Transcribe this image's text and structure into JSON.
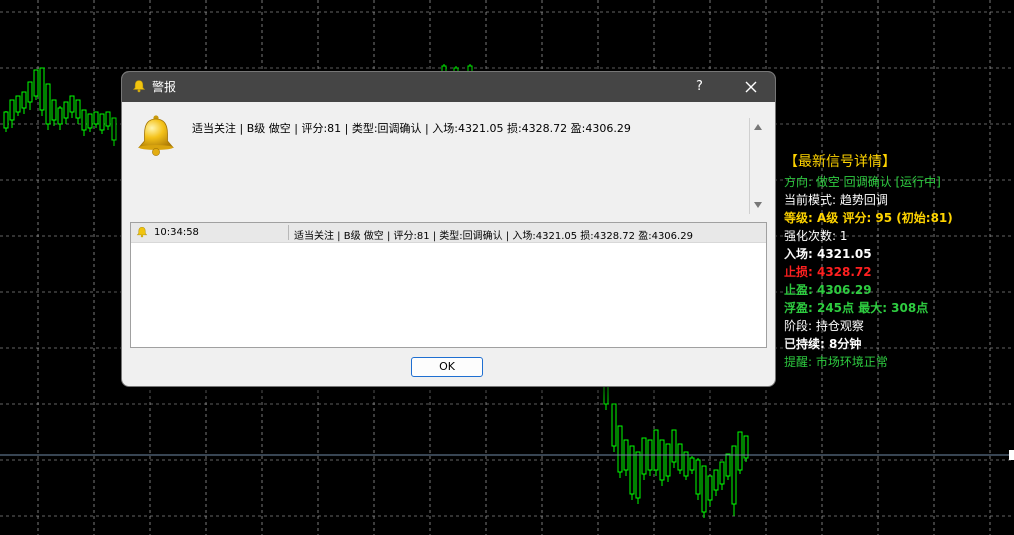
{
  "dialog": {
    "title": "警报",
    "help_label": "?",
    "close_icon": "close-icon",
    "message": "适当关注 | B级 做空 | 评分:81 | 类型:回调确认 | 入场:4321.05 损:4328.72 盈:4306.29",
    "log": [
      {
        "time": "10:34:58",
        "text": "适当关注 | B级 做空 | 评分:81 | 类型:回调确认 | 入场:4321.05 损:4328.72 盈:4306.29"
      }
    ],
    "ok_label": "OK"
  },
  "signal_panel": {
    "title": "【最新信号详情】",
    "lines": [
      {
        "text": "方向: 做空 回调确认 [运行中]",
        "color": "#2ecc40",
        "bold": false
      },
      {
        "text": "当前模式: 趋势回调",
        "color": "#ffffff",
        "bold": false
      },
      {
        "text": "等级: A级 评分: 95 (初始:81)",
        "color": "#ffd400",
        "bold": true
      },
      {
        "text": "强化次数: 1",
        "color": "#ffffff",
        "bold": false
      },
      {
        "text": "入场: 4321.05",
        "color": "#ffffff",
        "bold": true
      },
      {
        "text": "止损: 4328.72",
        "color": "#ff2020",
        "bold": true
      },
      {
        "text": "止盈: 4306.29",
        "color": "#2ecc40",
        "bold": true
      },
      {
        "text": "浮盈: 245点 最大: 308点",
        "color": "#2ecc40",
        "bold": true
      },
      {
        "text": "阶段: 持仓观察",
        "color": "#ffffff",
        "bold": false
      },
      {
        "text": "已持续: 8分钟",
        "color": "#ffffff",
        "bold": true
      },
      {
        "text": "提醒: 市场环境正常",
        "color": "#2ecc40",
        "bold": false
      }
    ]
  },
  "chart": {
    "background": "#000000",
    "grid_color": "#c8c8c8",
    "bull_color": "#00ff00",
    "bear_color": "#000000",
    "bid_line_color": "#6f8aa6"
  }
}
